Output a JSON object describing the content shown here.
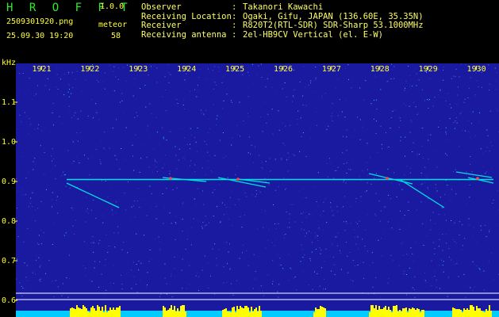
{
  "app": {
    "title": "H R O F F T",
    "version": "1.0.0"
  },
  "file": {
    "name": "2509301920.png",
    "datetime": "25.09.30 19:20"
  },
  "meteor": {
    "label": "meteor",
    "count": "58"
  },
  "info": [
    {
      "key": "Observer",
      "value": "Takanori Kawachi"
    },
    {
      "key": "Receiving Location",
      "value": "Ogaki, Gifu, JAPAN (136.60E, 35.35N)"
    },
    {
      "key": "Receiver",
      "value": "R820T2(RTL-SDR) SDR-Sharp 53.1000MHz"
    },
    {
      "key": "Receiving antenna",
      "value": "2el-HB9CV Vertical (el. E-W)"
    }
  ],
  "chart_data": {
    "type": "heatmap",
    "y_unit": "kHz",
    "x_ticks": [
      "1921",
      "1922",
      "1923",
      "1924",
      "1925",
      "1926",
      "1927",
      "1928",
      "1929",
      "1930"
    ],
    "y_ticks": [
      "1.1",
      "1.0",
      "0.9",
      "0.8",
      "0.7",
      "0.6"
    ],
    "carrier_khz": 0.905,
    "colors": {
      "background": "#1a1aa0",
      "signal": "#00e0e0",
      "peak": "#ff4040",
      "level": "#ffff00",
      "level_bg": "#00ccff"
    }
  }
}
